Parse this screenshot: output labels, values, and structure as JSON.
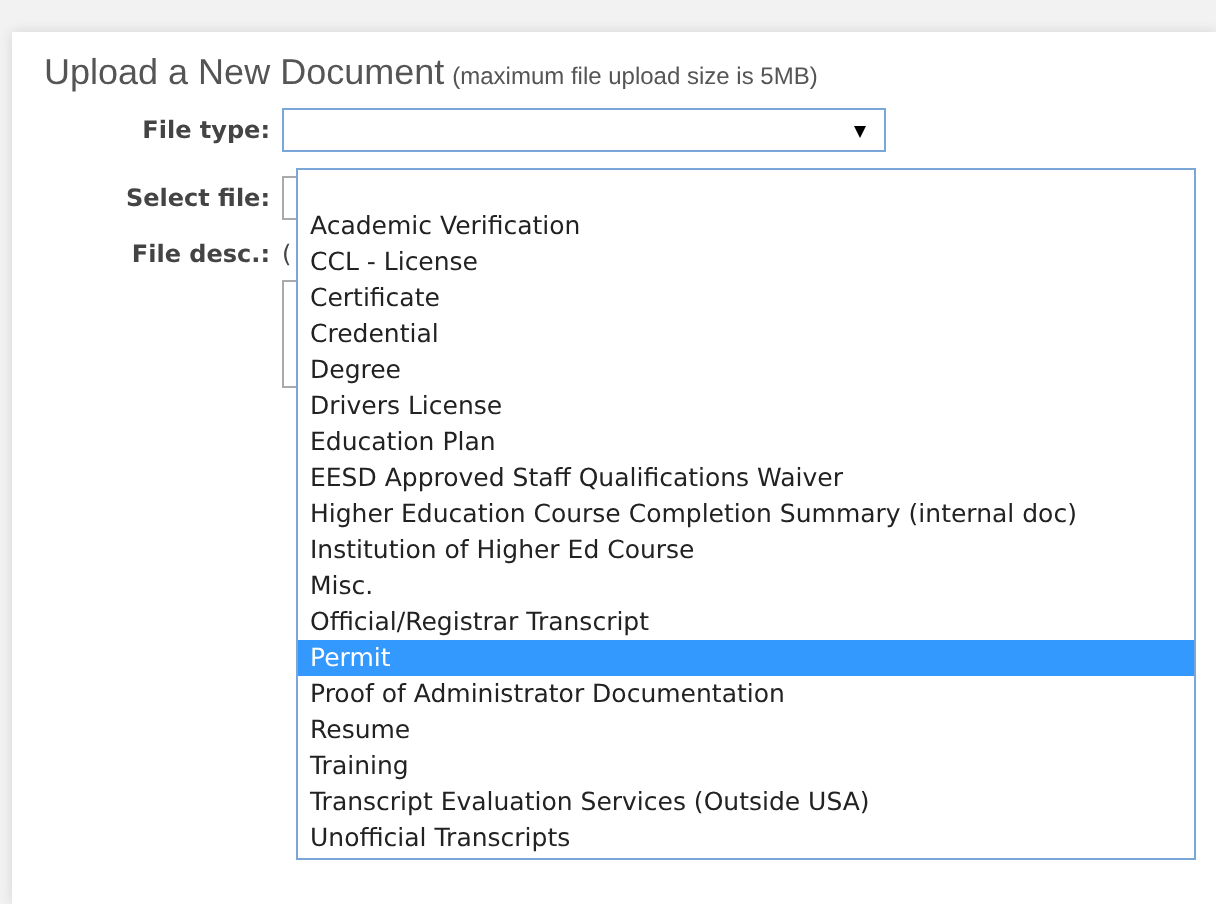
{
  "title": "Upload a New Document",
  "title_note": "(maximum file upload size is 5MB)",
  "fields": [
    {
      "label": "File type:",
      "kind": "select"
    },
    {
      "label": "Select file:",
      "kind": "file"
    },
    {
      "label": "File desc.:",
      "kind": "textarea",
      "note": "("
    }
  ],
  "dropdown": {
    "expanded": true,
    "options": [
      {
        "label": "Academic Verification",
        "selected": false
      },
      {
        "label": "CCL - License",
        "selected": false
      },
      {
        "label": "Certificate",
        "selected": false
      },
      {
        "label": "Credential",
        "selected": false
      },
      {
        "label": "Degree",
        "selected": false
      },
      {
        "label": "Drivers License",
        "selected": false
      },
      {
        "label": "Education Plan",
        "selected": false
      },
      {
        "label": "EESD Approved Staff Qualifications Waiver",
        "selected": false
      },
      {
        "label": "Higher Education Course Completion Summary (internal doc)",
        "selected": false
      },
      {
        "label": "Institution of Higher Ed Course",
        "selected": false
      },
      {
        "label": "Misc.",
        "selected": false
      },
      {
        "label": "Official/Registrar Transcript",
        "selected": false
      },
      {
        "label": "Permit",
        "selected": true
      },
      {
        "label": "Proof of Administrator Documentation",
        "selected": false
      },
      {
        "label": "Resume",
        "selected": false
      },
      {
        "label": "Training",
        "selected": false
      },
      {
        "label": "Transcript Evaluation Services (Outside USA)",
        "selected": false
      },
      {
        "label": "Unofficial Transcripts",
        "selected": false
      }
    ]
  }
}
